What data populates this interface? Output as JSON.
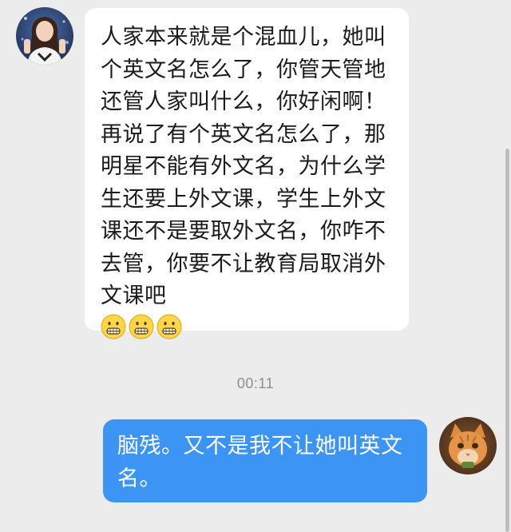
{
  "conversation": {
    "received": {
      "text": "人家本来就是个混血儿，她叫个英文名怎么了，你管天管地还管人家叫什么，你好闲啊！再说了有个英文名怎么了，那明星不能有外文名，为什么学生还要上外文课，学生上外文课还不是要取外文名，你咋不去管，你要不让教育局取消外文课吧",
      "emojis": [
        "grimace-emoji",
        "grimace-emoji",
        "grimace-emoji"
      ]
    },
    "timestamp": "00:11",
    "sent": {
      "text": "脑残。又不是我不让她叫英文名。"
    }
  },
  "colors": {
    "background": "#ececec",
    "received_bubble": "#ffffff",
    "sent_bubble": "#3c95f5",
    "sent_text": "#ffffff",
    "timestamp_text": "#8e8e8e"
  }
}
